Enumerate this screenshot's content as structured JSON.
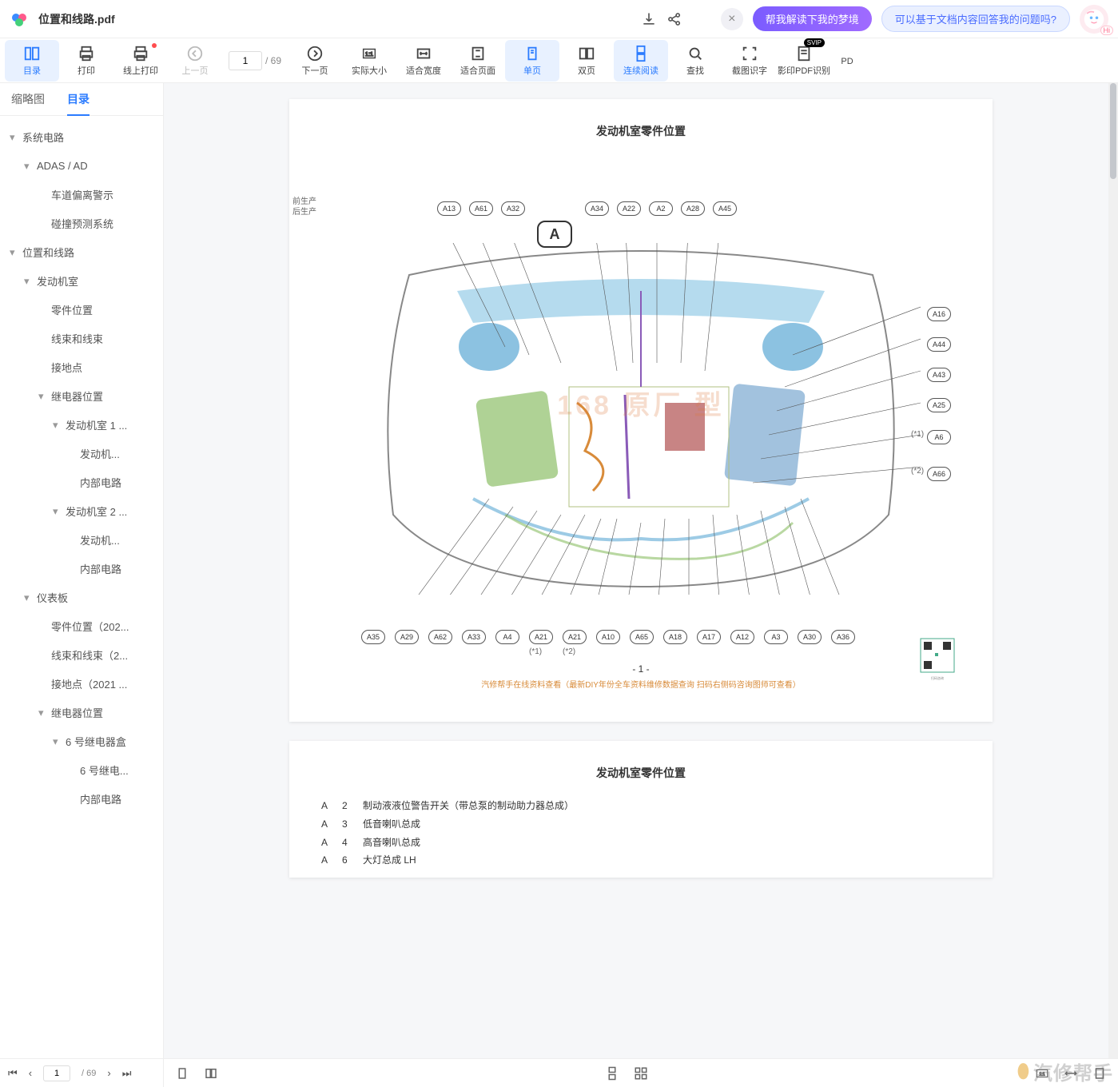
{
  "titlebar": {
    "filename": "位置和线路.pdf",
    "pill1": "帮我解读下我的梦境",
    "pill2": "可以基于文档内容回答我的问题吗?",
    "hi": "Hi"
  },
  "toolbar": {
    "catalog": "目录",
    "print": "打印",
    "online_print": "线上打印",
    "prev": "上一页",
    "next": "下一页",
    "actual": "实际大小",
    "fit_width": "适合宽度",
    "fit_page": "适合页面",
    "single": "单页",
    "double": "双页",
    "cont": "连续阅读",
    "find": "查找",
    "ocr": "截图识字",
    "pdf_ocr": "影印PDF识别",
    "pdf_more": "PD",
    "svip": "SVIP",
    "page_cur": "1",
    "page_total": "/ 69"
  },
  "sidebar": {
    "tabs": {
      "thumb": "缩略图",
      "toc": "目录"
    },
    "items": [
      {
        "d": 0,
        "exp": true,
        "label": "系统电路"
      },
      {
        "d": 1,
        "exp": true,
        "label": "ADAS / AD"
      },
      {
        "d": 2,
        "exp": false,
        "label": "车道偏离警示"
      },
      {
        "d": 2,
        "exp": false,
        "label": "碰撞预测系统"
      },
      {
        "d": 0,
        "exp": true,
        "label": "位置和线路"
      },
      {
        "d": 1,
        "exp": true,
        "label": "发动机室"
      },
      {
        "d": 2,
        "exp": false,
        "label": "零件位置"
      },
      {
        "d": 2,
        "exp": false,
        "label": "线束和线束"
      },
      {
        "d": 2,
        "exp": false,
        "label": "接地点"
      },
      {
        "d": 2,
        "exp": true,
        "label": "继电器位置"
      },
      {
        "d": 3,
        "exp": true,
        "label": "发动机室 1 ..."
      },
      {
        "d": 4,
        "exp": false,
        "label": "发动机..."
      },
      {
        "d": 4,
        "exp": false,
        "label": "内部电路"
      },
      {
        "d": 3,
        "exp": true,
        "label": "发动机室 2 ..."
      },
      {
        "d": 4,
        "exp": false,
        "label": "发动机..."
      },
      {
        "d": 4,
        "exp": false,
        "label": "内部电路"
      },
      {
        "d": 1,
        "exp": true,
        "label": "仪表板"
      },
      {
        "d": 2,
        "exp": false,
        "label": "零件位置（202..."
      },
      {
        "d": 2,
        "exp": false,
        "label": "线束和线束（2..."
      },
      {
        "d": 2,
        "exp": false,
        "label": "接地点（2021 ..."
      },
      {
        "d": 2,
        "exp": true,
        "label": "继电器位置"
      },
      {
        "d": 3,
        "exp": true,
        "label": "6 号继电器盒"
      },
      {
        "d": 4,
        "exp": false,
        "label": "6 号继电..."
      },
      {
        "d": 4,
        "exp": false,
        "label": "内部电路"
      }
    ],
    "footer": {
      "page_cur": "1",
      "page_total": "/ 69"
    }
  },
  "page1": {
    "title": "发动机室零件位置",
    "cutoff1": "前生产",
    "cutoff2": "后生产",
    "bigA": "A",
    "topLabels": [
      "A13",
      "A61",
      "A32",
      "A34",
      "A22",
      "A2",
      "A28",
      "A45"
    ],
    "rightLabels": [
      "A16",
      "A44",
      "A43",
      "A25",
      "A6",
      "A66"
    ],
    "rightNotes": [
      "(*1)",
      "(*2)"
    ],
    "bottomLabels": [
      "A35",
      "A29",
      "A62",
      "A33",
      "A4",
      "A21",
      "A21",
      "A10",
      "A65",
      "A18",
      "A17",
      "A12",
      "A3",
      "A30",
      "A36"
    ],
    "bottomNotes": [
      "(*1)",
      "(*2)"
    ],
    "pageNum": "- 1 -",
    "footerTxt": "汽修帮手在线资料查看（最新DIY年份全车资料维修数据查询 扫码右侧码咨询图师可查看）",
    "watermark": "168     原厂     型"
  },
  "page2": {
    "title": "发动机室零件位置",
    "rows": [
      [
        "A",
        "2",
        "制动液液位警告开关（带总泵的制动助力器总成）"
      ],
      [
        "A",
        "3",
        "低音喇叭总成"
      ],
      [
        "A",
        "4",
        "高音喇叭总成"
      ],
      [
        "A",
        "6",
        "大灯总成 LH"
      ]
    ]
  },
  "brand": "汽修帮手"
}
